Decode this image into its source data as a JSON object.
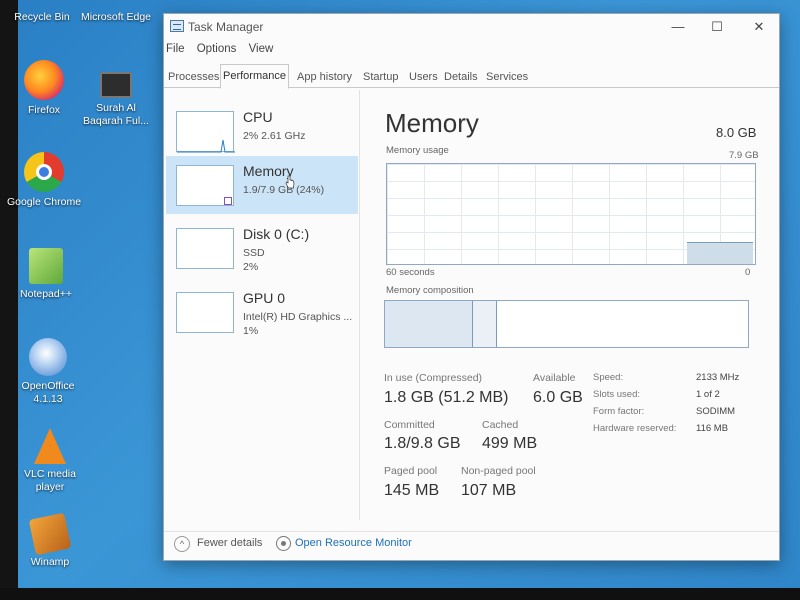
{
  "desktop": {
    "icons": [
      {
        "label": "Recycle Bin"
      },
      {
        "label": "Microsoft Edge"
      },
      {
        "label": "Firefox"
      },
      {
        "label": "Surah Al Baqarah Ful..."
      },
      {
        "label": "Google Chrome"
      },
      {
        "label": "Notepad++"
      },
      {
        "label": "OpenOffice 4.1.13"
      },
      {
        "label": "VLC media player"
      },
      {
        "label": "Winamp"
      }
    ]
  },
  "window": {
    "title": "Task Manager",
    "controls": {
      "minimize": "—",
      "maximize": "☐",
      "close": "✕"
    }
  },
  "menu": [
    "File",
    "Options",
    "View"
  ],
  "tabs": [
    "Processes",
    "Performance",
    "App history",
    "Startup",
    "Users",
    "Details",
    "Services"
  ],
  "active_tab": "Performance",
  "resources": [
    {
      "name": "CPU",
      "sub1": "2%  2.61 GHz",
      "sub2": ""
    },
    {
      "name": "Memory",
      "sub1": "1.9/7.9 GB (24%)",
      "sub2": ""
    },
    {
      "name": "Disk 0 (C:)",
      "sub1": "SSD",
      "sub2": "2%"
    },
    {
      "name": "GPU 0",
      "sub1": "Intel(R) HD Graphics ...",
      "sub2": "1%"
    }
  ],
  "selected_resource": "Memory",
  "detail": {
    "title": "Memory",
    "total": "8.0 GB",
    "usage_label": "Memory usage",
    "usage_max": "7.9 GB",
    "time_label": "60 seconds",
    "time_end": "0",
    "composition_label": "Memory composition",
    "stats": [
      {
        "label": "In use (Compressed)",
        "value": "1.8 GB (51.2 MB)"
      },
      {
        "label": "Available",
        "value": "6.0 GB"
      },
      {
        "label": "Committed",
        "value": "1.8/9.8 GB"
      },
      {
        "label": "Cached",
        "value": "499 MB"
      },
      {
        "label": "Paged pool",
        "value": "145 MB"
      },
      {
        "label": "Non-paged pool",
        "value": "107 MB"
      }
    ],
    "specs": [
      {
        "label": "Speed:",
        "value": "2133 MHz"
      },
      {
        "label": "Slots used:",
        "value": "1 of 2"
      },
      {
        "label": "Form factor:",
        "value": "SODIMM"
      },
      {
        "label": "Hardware reserved:",
        "value": "116 MB"
      }
    ],
    "usage_fraction": 0.24
  },
  "footer": {
    "fewer_details": "Fewer details",
    "open_resource_monitor": "Open Resource Monitor"
  }
}
